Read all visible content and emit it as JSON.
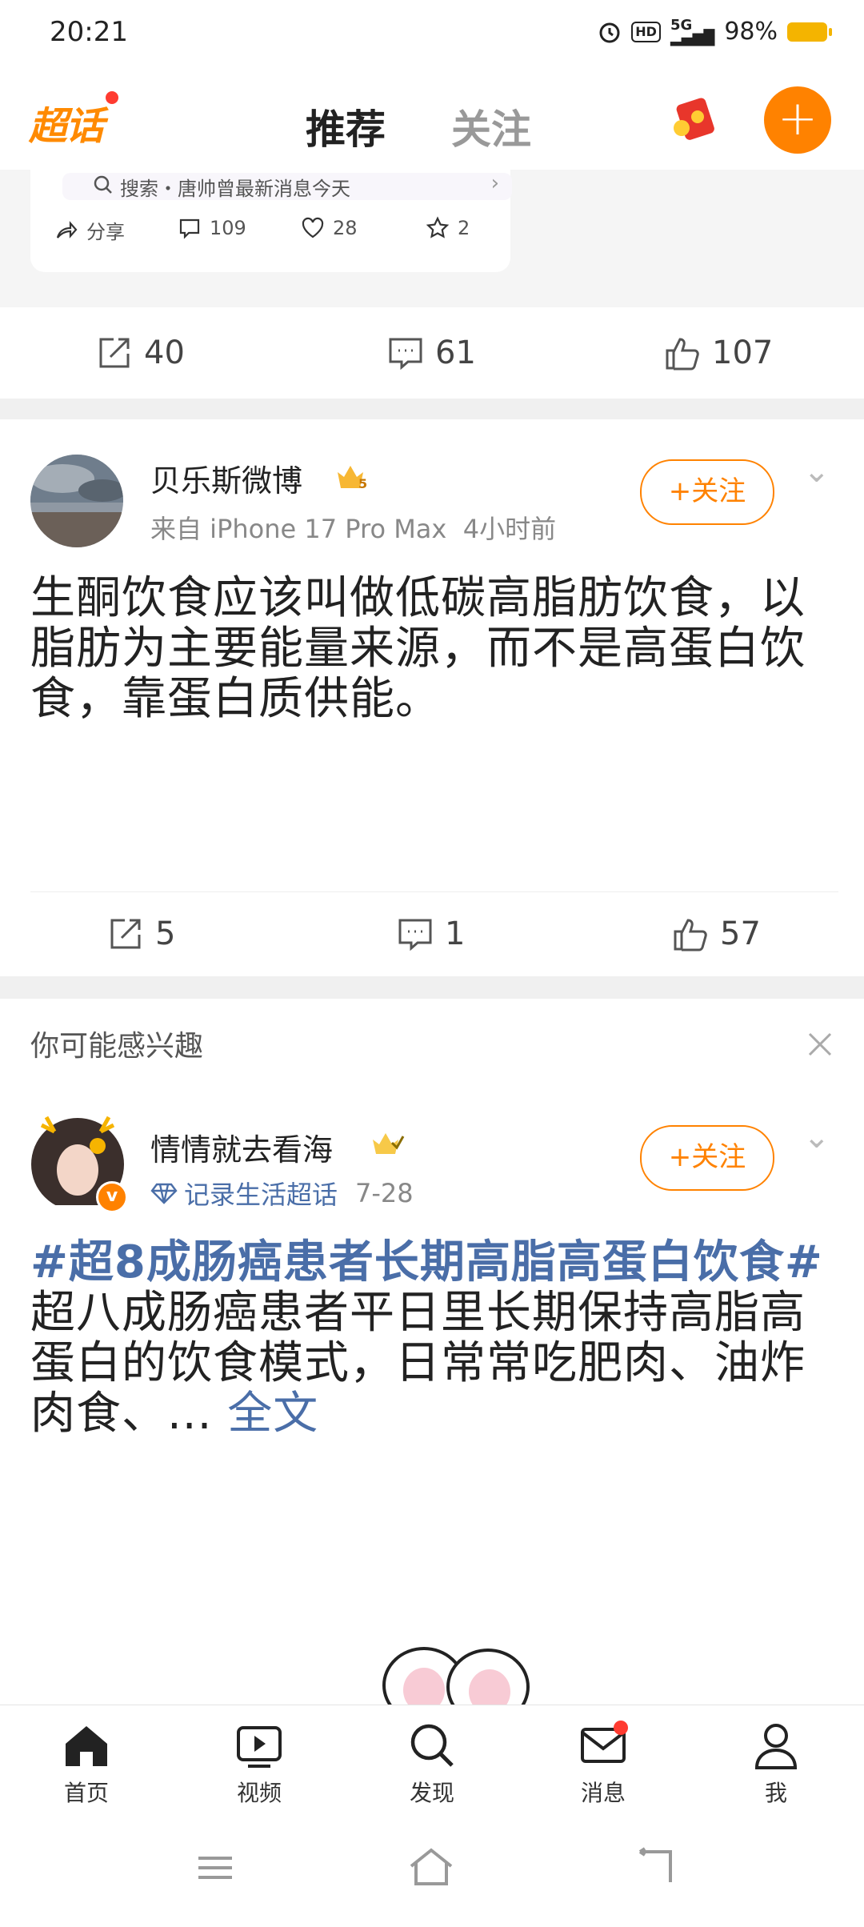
{
  "status": {
    "time": "20:21",
    "network": "5G",
    "battery": "98%"
  },
  "header": {
    "logo": "超话",
    "tab_active": "推荐",
    "tab_inactive": "关注"
  },
  "partial_card": {
    "search_text": "搜索・唐帅曾最新消息今天",
    "share_label": "分享",
    "comments": "109",
    "likes": "28",
    "favorites": "2"
  },
  "row1": {
    "reposts": "40",
    "comments": "61",
    "likes": "107"
  },
  "post1": {
    "username": "贝乐斯微博",
    "source": "来自 iPhone 17 Pro Max",
    "time": "4小时前",
    "follow": "+关注",
    "text": "生酮饮食应该叫做低碳高脂肪饮食，以脂肪为主要能量来源，而不是高蛋白饮食，靠蛋白质供能。",
    "reposts": "5",
    "comments": "1",
    "likes": "57"
  },
  "interest": {
    "label": "你可能感兴趣"
  },
  "post2": {
    "username": "情情就去看海",
    "supertopic": "记录生活超话",
    "date": "7-28",
    "follow": "+关注",
    "topic": "#超8成肠癌患者长期高脂高蛋白饮食#",
    "text": "超八成肠癌患者平日里长期保持高脂高蛋白的饮食模式，日常常吃肥肉、油炸肉食、... ",
    "more": "全文"
  },
  "nav": {
    "home": "首页",
    "video": "视频",
    "discover": "发现",
    "messages": "消息",
    "me": "我"
  },
  "colors": {
    "accent": "#ff8200",
    "topic": "#4a6ea8"
  }
}
